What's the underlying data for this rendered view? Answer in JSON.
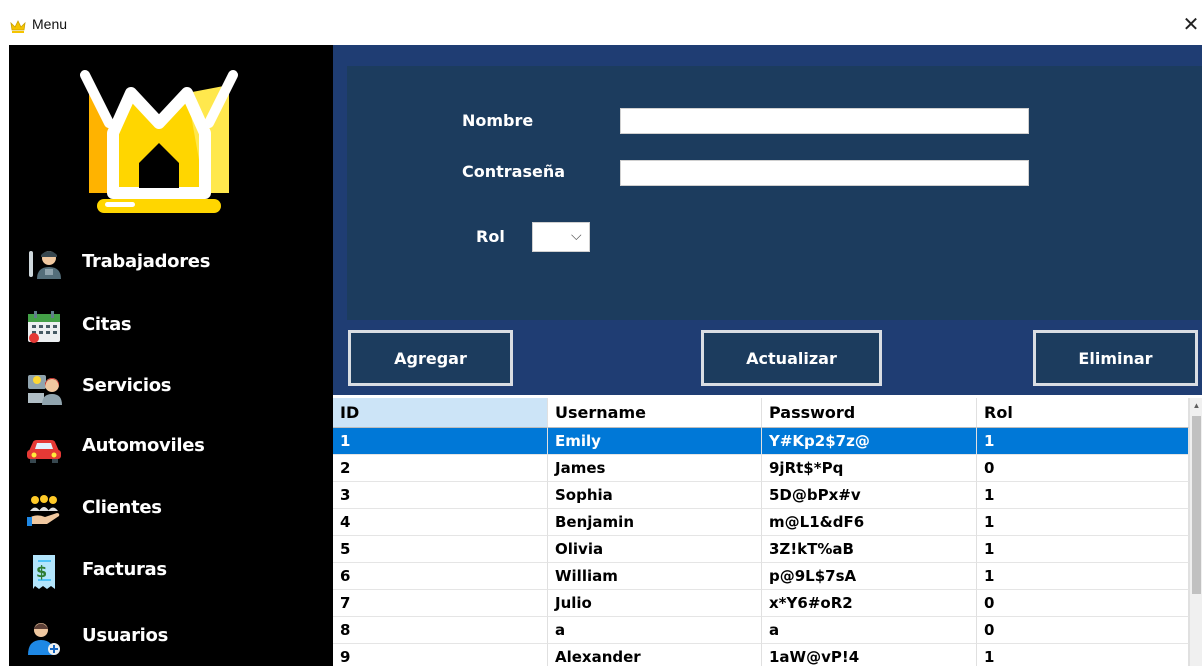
{
  "window": {
    "title": "Menu",
    "close_glyph": "✕"
  },
  "sidebar": {
    "logo": "crown-logo",
    "items": [
      {
        "label": "Trabajadores",
        "icon": "mechanic-icon"
      },
      {
        "label": "Citas",
        "icon": "calendar-icon"
      },
      {
        "label": "Servicios",
        "icon": "customer-service-icon"
      },
      {
        "label": "Automoviles",
        "icon": "car-icon"
      },
      {
        "label": "Clientes",
        "icon": "clients-icon"
      },
      {
        "label": "Facturas",
        "icon": "invoice-icon"
      },
      {
        "label": "Usuarios",
        "icon": "add-user-icon"
      }
    ]
  },
  "form": {
    "nombre_label": "Nombre",
    "nombre_value": "",
    "contrasena_label": "Contraseña",
    "contrasena_value": "",
    "rol_label": "Rol",
    "rol_value": ""
  },
  "actions": {
    "add": "Agregar",
    "update": "Actualizar",
    "delete": "Eliminar"
  },
  "table": {
    "columns": [
      "ID",
      "Username",
      "Password",
      "Rol"
    ],
    "rows": [
      [
        "1",
        "Emily",
        "Y#Kp2$7z@",
        "1"
      ],
      [
        "2",
        "James",
        "9jRt$*Pq",
        "0"
      ],
      [
        "3",
        "Sophia",
        "5D@bPx#v",
        "1"
      ],
      [
        "4",
        "Benjamin",
        "m@L1&dF6",
        "1"
      ],
      [
        "5",
        "Olivia",
        "3Z!kT%aB",
        "1"
      ],
      [
        "6",
        "William",
        "p@9L$7sA",
        "1"
      ],
      [
        "7",
        "Julio",
        "x*Y6#oR2",
        "0"
      ],
      [
        "8",
        "a",
        "a",
        "0"
      ],
      [
        "9",
        "Alexander",
        "1aW@vP!4",
        "1"
      ]
    ],
    "selected_row": 0
  },
  "colors": {
    "sidebar_bg": "#000000",
    "main_bg": "#1f3d73",
    "panel_bg": "#1c3c5e",
    "selection": "#0078d7",
    "logo_yellow": "#ffd600"
  }
}
